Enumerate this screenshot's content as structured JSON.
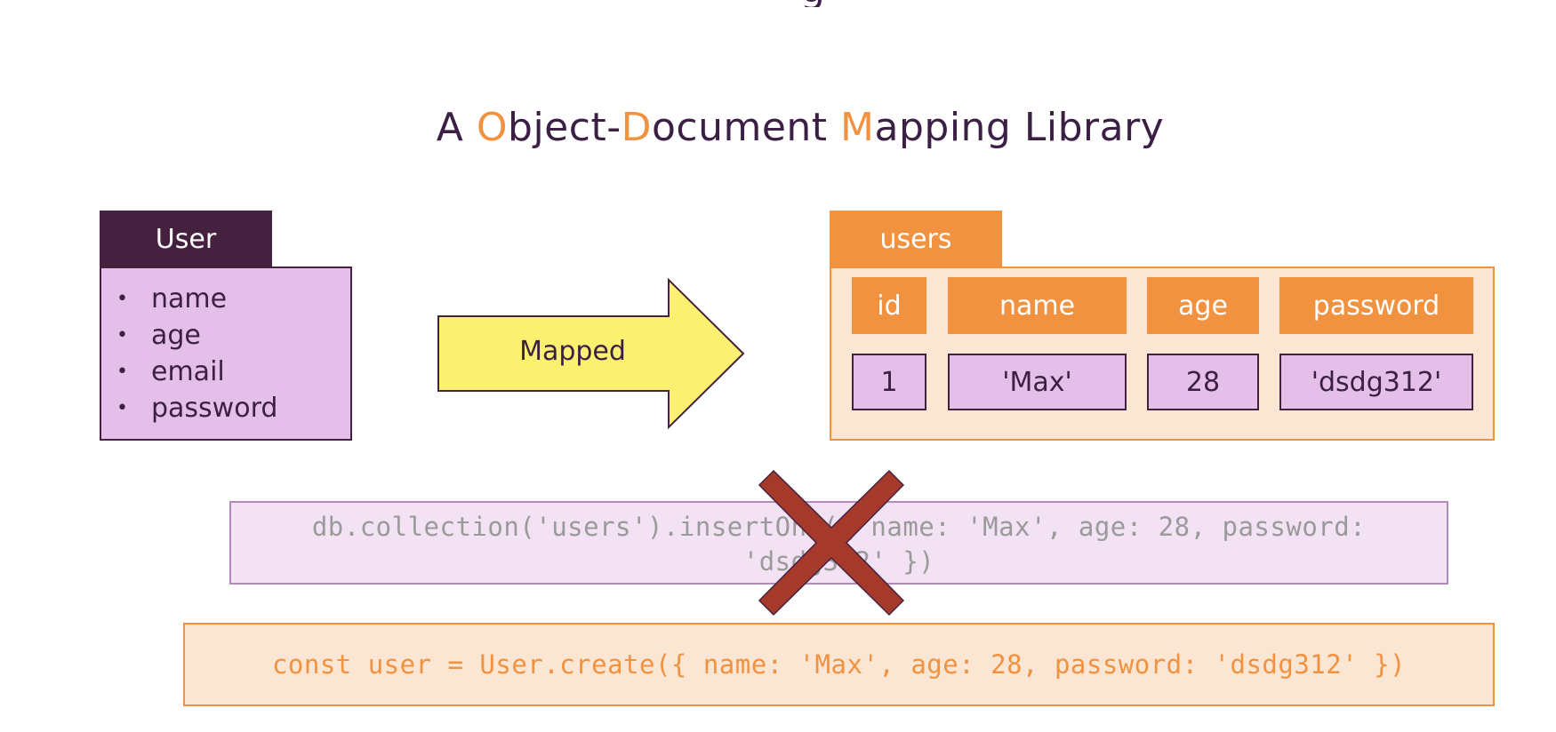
{
  "title_fragment": "g",
  "subtitle": {
    "parts": [
      {
        "text": "A ",
        "highlight": false
      },
      {
        "text": "O",
        "highlight": true
      },
      {
        "text": "bject-",
        "highlight": false
      },
      {
        "text": "D",
        "highlight": true
      },
      {
        "text": "ocument ",
        "highlight": false
      },
      {
        "text": "M",
        "highlight": true
      },
      {
        "text": "apping Library",
        "highlight": false
      }
    ]
  },
  "model": {
    "title": "User",
    "fields": [
      "name",
      "age",
      "email",
      "password"
    ],
    "bullet": "•"
  },
  "arrow": {
    "label": "Mapped",
    "color": "#fbf06f"
  },
  "collection": {
    "title": "users",
    "columns": [
      "id",
      "name",
      "age",
      "password"
    ],
    "row": [
      "1",
      "'Max'",
      "28",
      "'dsdg312'"
    ]
  },
  "native_query": {
    "line1": "db.collection('users').insertOne({ name: 'Max', age: 28, password:",
    "line2": "'dsdg312' })",
    "status_icon": "cross-icon",
    "status_color": "#a63a2a"
  },
  "odm_query": {
    "text": "const user = User.create({ name: 'Max', age: 28, password: 'dsdg312' })"
  },
  "colors": {
    "dark_purple": "#43213f",
    "light_purple": "#e4bfe9",
    "orange": "#f0923f",
    "light_orange": "#fbe5d3"
  }
}
